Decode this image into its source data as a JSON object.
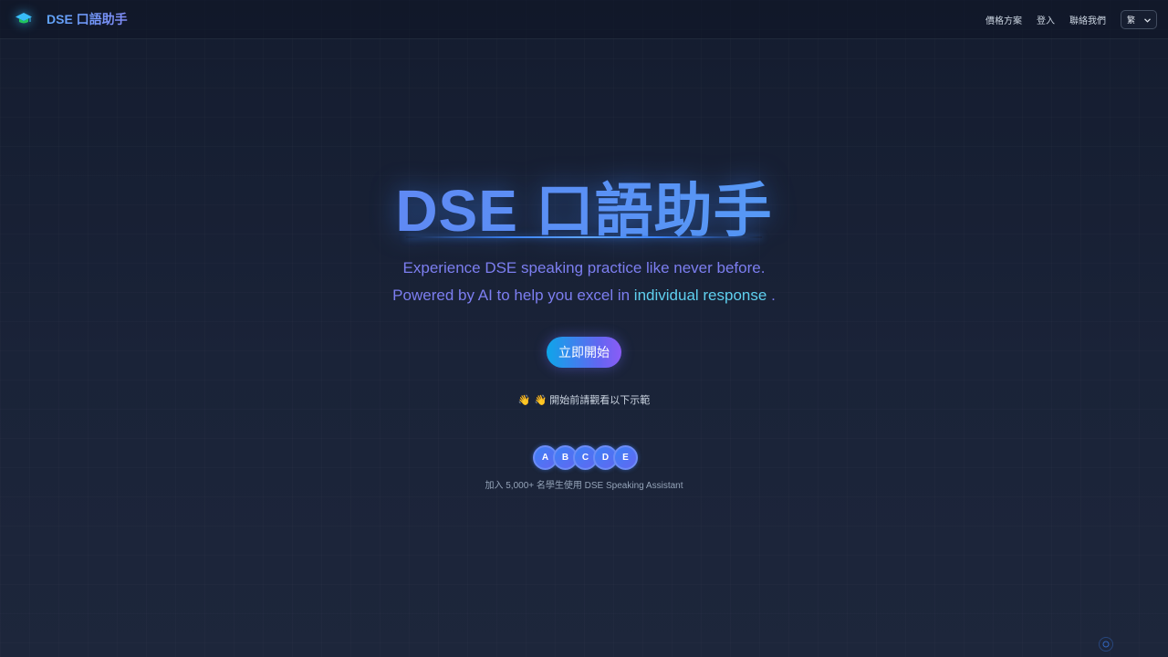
{
  "header": {
    "logo_text": "DSE 口語助手",
    "logo_icon": "graduation-cap-icon",
    "nav": {
      "pricing": "價格方案",
      "login": "登入",
      "contact": "聯絡我們"
    },
    "language": "繁"
  },
  "hero": {
    "title": "DSE 口語助手",
    "subtitle_line1": "Experience DSE speaking practice like never before.",
    "subtitle_line2_prefix": "Powered by AI to help you excel in",
    "subtitle_line2_highlight": "individual response",
    "subtitle_line2_suffix": ".",
    "cta_label": "立即開始",
    "demo_hint_icon": "👋",
    "demo_hint": "👋 開始前請觀看以下示範",
    "avatars": [
      "A",
      "B",
      "C",
      "D",
      "E"
    ],
    "join_text": "加入 5,000+ 名學生使用 DSE Speaking Assistant"
  },
  "colors": {
    "accent": "#3b82f6",
    "highlight": "#5fd0ef",
    "subtitle": "#7c7ef0",
    "background": "#1a2338"
  }
}
